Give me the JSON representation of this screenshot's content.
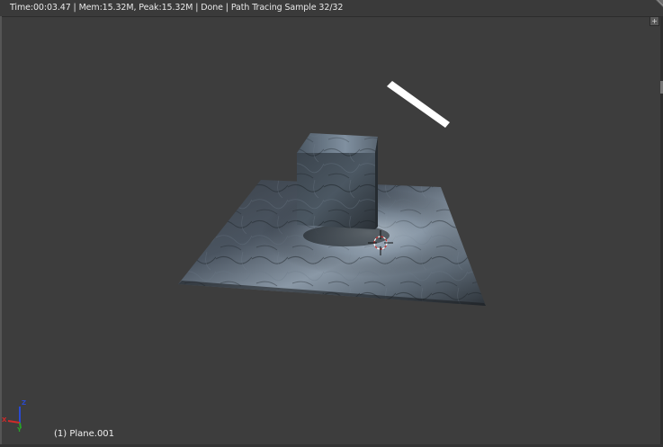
{
  "status_bar": {
    "text": "Time:00:03.47 | Mem:15.32M, Peak:15.32M | Done | Path Tracing Sample 32/32"
  },
  "viewport": {
    "active_object_label": "(1) Plane.001",
    "render_mode": "rendered",
    "axis_letters": {
      "z": "Z",
      "x": "X",
      "y": "Y"
    },
    "colors": {
      "background": "#3d3d3d",
      "axis_x": "#d02a2a",
      "axis_y": "#2aa02a",
      "axis_z": "#2a4ad0",
      "cursor_ring": "#c83232",
      "lamp": "#ffffff"
    }
  },
  "icons": {
    "corner_widget": "plus-icon",
    "corner_triangle": "region-corner-icon"
  }
}
